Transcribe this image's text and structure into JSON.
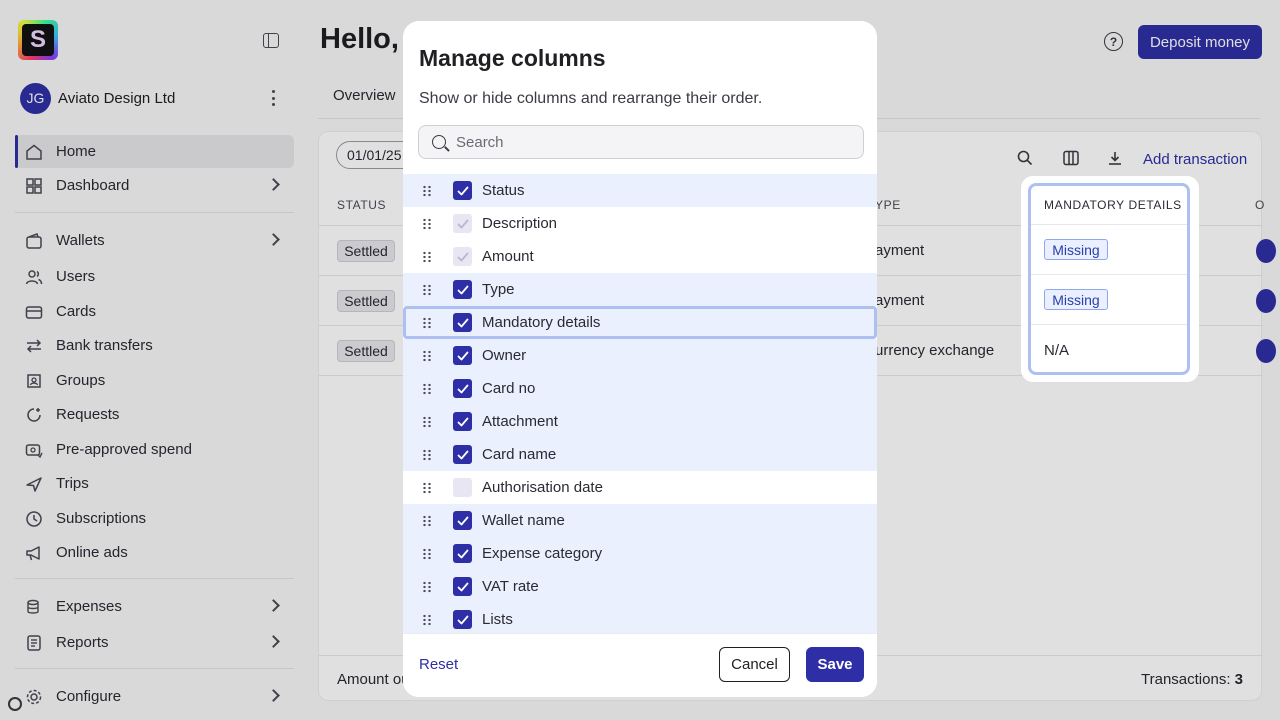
{
  "sidebar": {
    "logo_letter": "S",
    "org": {
      "initials": "JG",
      "name": "Aviato Design Ltd"
    },
    "nav": [
      {
        "label": "Home",
        "icon": "home-icon"
      },
      {
        "label": "Dashboard",
        "icon": "dashboard-icon"
      },
      {
        "label": "Wallets",
        "icon": "wallet-icon"
      },
      {
        "label": "Users",
        "icon": "users-icon"
      },
      {
        "label": "Cards",
        "icon": "card-icon"
      },
      {
        "label": "Bank transfers",
        "icon": "transfer-icon"
      },
      {
        "label": "Groups",
        "icon": "groups-icon"
      },
      {
        "label": "Requests",
        "icon": "requests-icon"
      },
      {
        "label": "Pre-approved spend",
        "icon": "pre-approved-icon"
      },
      {
        "label": "Trips",
        "icon": "plane-icon"
      },
      {
        "label": "Subscriptions",
        "icon": "subscriptions-icon"
      },
      {
        "label": "Online ads",
        "icon": "megaphone-icon"
      },
      {
        "label": "Expenses",
        "icon": "expenses-icon"
      },
      {
        "label": "Reports",
        "icon": "reports-icon"
      },
      {
        "label": "Configure",
        "icon": "configure-icon"
      }
    ]
  },
  "header": {
    "greeting": "Hello, J",
    "help_glyph": "?",
    "deposit_label": "Deposit money",
    "tab_overview": "Overview"
  },
  "table": {
    "date_chip": "01/01/25",
    "add_transaction": "Add transaction",
    "col_status": "STATUS",
    "col_type": "YPE",
    "col_owner_partial": "O",
    "rows": [
      {
        "status": "Settled",
        "type": "ayment",
        "mandatory": "Missing"
      },
      {
        "status": "Settled",
        "type": "ayment",
        "mandatory": "Missing"
      },
      {
        "status": "Settled",
        "type": "urrency exchange",
        "mandatory": "N/A"
      }
    ],
    "footer_amount": "Amount ou",
    "footer_tx_label": "Transactions:",
    "footer_tx_count": "3"
  },
  "spotlight": {
    "header": "MANDATORY DETAILS"
  },
  "modal": {
    "title": "Manage columns",
    "subtitle": "Show or hide columns and rearrange their order.",
    "search_placeholder": "Search",
    "columns": [
      {
        "label": "Status",
        "checked": true,
        "disabled": false
      },
      {
        "label": "Description",
        "checked": true,
        "disabled": true
      },
      {
        "label": "Amount",
        "checked": true,
        "disabled": true
      },
      {
        "label": "Type",
        "checked": true,
        "disabled": false
      },
      {
        "label": "Mandatory details",
        "checked": true,
        "disabled": false,
        "selected": true
      },
      {
        "label": "Owner",
        "checked": true,
        "disabled": false
      },
      {
        "label": "Card no",
        "checked": true,
        "disabled": false
      },
      {
        "label": "Attachment",
        "checked": true,
        "disabled": false
      },
      {
        "label": "Card name",
        "checked": true,
        "disabled": false
      },
      {
        "label": "Authorisation date",
        "checked": false,
        "disabled": true
      },
      {
        "label": "Wallet name",
        "checked": true,
        "disabled": false
      },
      {
        "label": "Expense category",
        "checked": true,
        "disabled": false
      },
      {
        "label": "VAT rate",
        "checked": true,
        "disabled": false
      },
      {
        "label": "Lists",
        "checked": true,
        "disabled": false
      }
    ],
    "reset_label": "Reset",
    "cancel_label": "Cancel",
    "save_label": "Save"
  },
  "colors": {
    "brand": "#2e2fa6",
    "highlight_row": "#eaf0fd",
    "highlight_border": "#aec0f2"
  }
}
